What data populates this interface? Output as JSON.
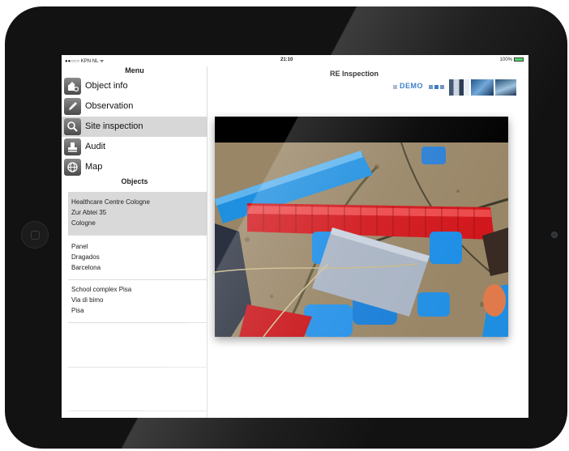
{
  "status": {
    "carrier": "●●○○○ KPN NL ᯤ",
    "time": "21:10",
    "battery": "100%"
  },
  "sidebar": {
    "menu_title": "Menu",
    "items": [
      {
        "label": "Object info",
        "icon": "object-info-icon",
        "active": false
      },
      {
        "label": "Observation",
        "icon": "pencil-icon",
        "active": false
      },
      {
        "label": "Site inspection",
        "icon": "magnifier-icon",
        "active": true
      },
      {
        "label": "Audit",
        "icon": "stamp-icon",
        "active": false
      },
      {
        "label": "Map",
        "icon": "globe-icon",
        "active": false
      }
    ],
    "objects_title": "Objects",
    "objects": [
      {
        "line1": "Healthcare Centre Cologne",
        "line2": "Zur Abtei 35",
        "line3": "Cologne",
        "active": true
      },
      {
        "line1": "Panel",
        "line2": "Dragados",
        "line3": "Barcelona",
        "active": false
      },
      {
        "line1": "School complex Pisa",
        "line2": "Via di bimo",
        "line3": "Pisa",
        "active": false
      }
    ]
  },
  "header": {
    "title": "RE Inspection",
    "logo_text": "DEMO"
  },
  "colors": {
    "accent": "#2a73c6",
    "active_row": "#d7d7d7"
  }
}
